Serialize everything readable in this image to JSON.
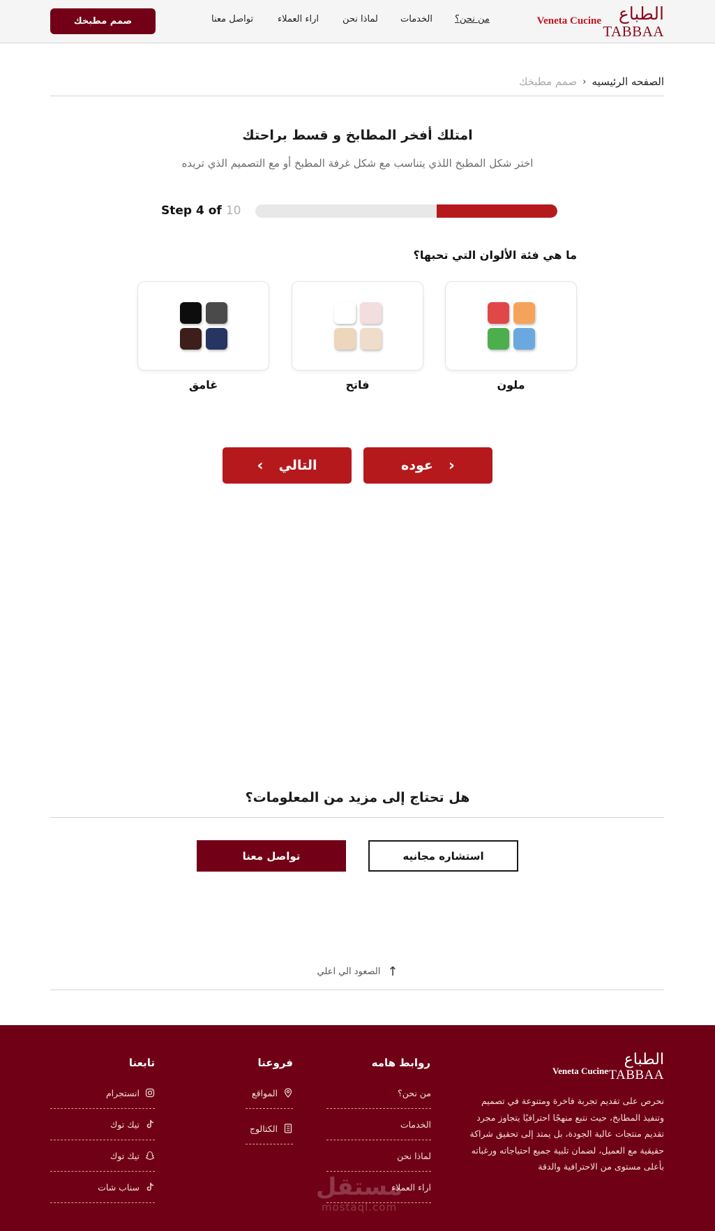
{
  "header": {
    "brand_ar": "الطباع",
    "brand_en": "TABBAA",
    "brand_partner": "Veneta Cucine",
    "nav": [
      "من نحن؟",
      "الخدمات",
      "لماذا نحن",
      "اراء العملاء",
      "تواصل معنا"
    ],
    "cta_label": "صمم مطبخك"
  },
  "breadcrumb": {
    "home": "الصفحه الرئيسيه",
    "separator": "›",
    "current": "صمم مطبخك"
  },
  "hero": {
    "title": "امتلك أفخر المطابخ و قسط براحتك",
    "subtitle": "اختر شكل المطبخ اللذي يتناسب مع شكل غرفة المطبخ أو مع التصميم الذي تريده"
  },
  "progress": {
    "step_prefix": "Step 4 of",
    "total": "10",
    "current_step": 4,
    "total_steps": 10,
    "fill_color": "#b5191c"
  },
  "question": {
    "text": "ما هي فئة الألوان التي تحبها؟",
    "options": [
      {
        "label": "ملون",
        "swatches": [
          "#e04848",
          "#f5a35a",
          "#4cae4c",
          "#6aa8e0"
        ]
      },
      {
        "label": "فاتح",
        "swatches": [
          "#ffffff",
          "#f2dede",
          "#ecd6bc",
          "#f0dccb"
        ]
      },
      {
        "label": "غامق",
        "swatches": [
          "#0d0d0d",
          "#4a4a4a",
          "#3d1e1a",
          "#263561"
        ]
      }
    ]
  },
  "nav_buttons": {
    "back_label": "عوده",
    "next_label": "التالي"
  },
  "more_info": {
    "title": "هل تحتاج إلى مزيد من المعلومات؟",
    "consult_label": "استشاره مجانيه",
    "contact_label": "تواصل معنا",
    "scroll_top_label": "الصعود الي اعلي"
  },
  "footer": {
    "brand_ar": "الطباع",
    "brand_en": "TABBAA",
    "brand_partner": "Veneta Cucine",
    "about": "نحرص على تقديم تجربة فاخرة ومتنوعة في تصميم وتنفيذ المطابخ، حيث نتبع منهجًا احترافيًا يتجاوز مجرد تقديم منتجات عالية الجودة، بل يمتد إلى تحقيق شراكة حقيقية مع العميل، لضمان تلبية جميع احتياجاته ورغباته بأعلى مستوى من الاحترافية والدقة",
    "links_title": "روابط هامه",
    "links": [
      "من نحن؟",
      "الخدمات",
      "لماذا نحن",
      "اراء العملاء"
    ],
    "branches_title": "فروعنا",
    "branches": [
      {
        "label": "المواقع",
        "icon": "location-pin-icon"
      },
      {
        "label": "الكتالوج",
        "icon": "catalog-icon"
      }
    ],
    "follow_title": "تابعنا",
    "social": [
      {
        "label": "انستجرام",
        "icon": "instagram-icon"
      },
      {
        "label": "تيك توك",
        "icon": "tiktok-icon"
      },
      {
        "label": "تيك توك",
        "icon": "snapchat-icon"
      },
      {
        "label": "سناب شات",
        "icon": "tiktok-icon"
      }
    ],
    "watermark_ar": "مستقل",
    "watermark_en": "mostaql.com"
  }
}
